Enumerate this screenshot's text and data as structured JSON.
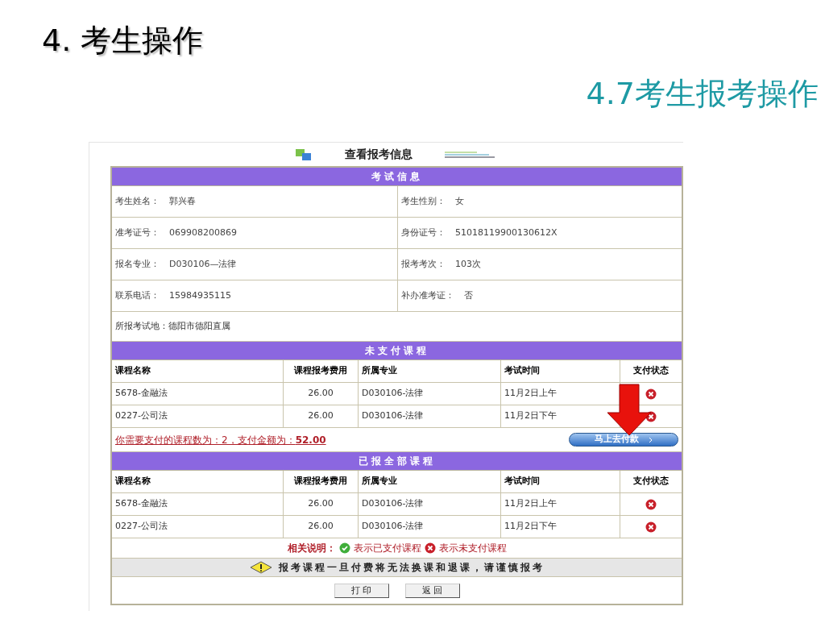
{
  "slide": {
    "heading": "4. 考生操作",
    "subheading": "4.7考生报考操作"
  },
  "page": {
    "title": "查看报考信息",
    "exam_info": {
      "title": "考试信息",
      "pairs": [
        [
          {
            "label": "考生姓名：",
            "value": "郭兴春"
          },
          {
            "label": "考生性别：",
            "value": "女"
          }
        ],
        [
          {
            "label": "准考证号：",
            "value": "069908200869"
          },
          {
            "label": "身份证号：",
            "value": "51018119900130612X"
          }
        ],
        [
          {
            "label": "报名专业：",
            "value": "D030106—法律"
          },
          {
            "label": "报考考次：",
            "value": "103次"
          }
        ],
        [
          {
            "label": "联系电话：",
            "value": "15984935115"
          },
          {
            "label": "补办准考证：",
            "value": "否"
          }
        ]
      ],
      "location": "所报考试地：德阳市德阳直属"
    },
    "unpaid": {
      "title": "未支付课程",
      "columns": [
        "课程名称",
        "课程报考费用",
        "所属专业",
        "考试时间",
        "支付状态"
      ],
      "rows": [
        {
          "name": "5678-金融法",
          "fee": "26.00",
          "major": "D030106-法律",
          "time": "11月2日上午",
          "paid": false
        },
        {
          "name": "0227-公司法",
          "fee": "26.00",
          "major": "D030106-法律",
          "time": "11月2日下午",
          "paid": false
        }
      ],
      "summary": "你需要支付的课程数为：2，支付金额为：**52.00**",
      "pay_button": "马上去付款"
    },
    "all": {
      "title": "已报全部课程",
      "columns": [
        "课程名称",
        "课程报考费用",
        "所属专业",
        "考试时间",
        "支付状态"
      ],
      "rows": [
        {
          "name": "5678-金融法",
          "fee": "26.00",
          "major": "D030106-法律",
          "time": "11月2日上午",
          "paid": false
        },
        {
          "name": "0227-公司法",
          "fee": "26.00",
          "major": "D030106-法律",
          "time": "11月2日下午",
          "paid": false
        }
      ]
    },
    "legend": {
      "label": "相关说明：",
      "paid": "表示已支付课程",
      "unpaid": "表示未支付课程"
    },
    "warning": "报考课程一旦付费将无法换课和退课，请谨慎报考",
    "buttons": [
      "打 印",
      "返 回"
    ]
  }
}
